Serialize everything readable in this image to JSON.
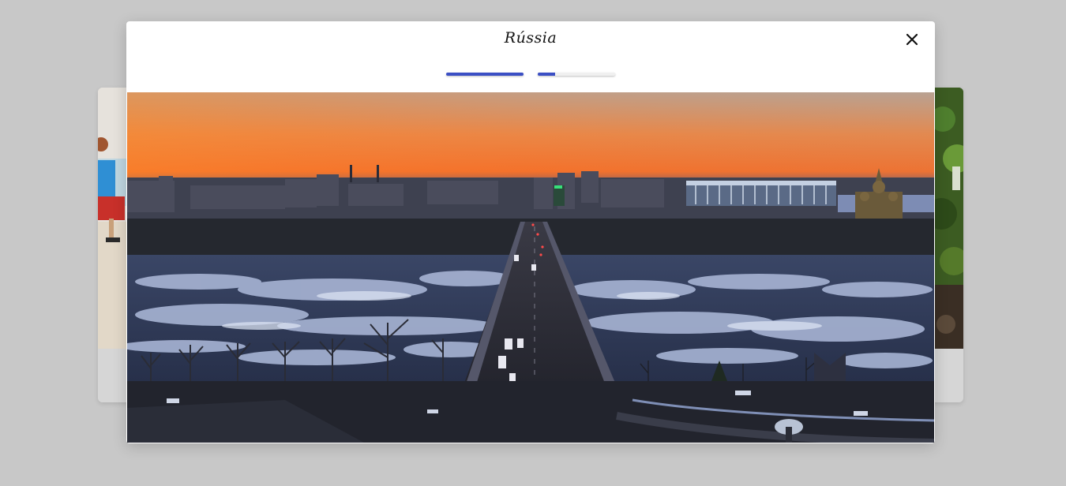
{
  "modal": {
    "title": "Rússia",
    "close_icon": "close-icon",
    "progress": [
      {
        "fraction": 1.0
      },
      {
        "fraction": 0.22
      }
    ],
    "image": {
      "subject": "city-skyline-bridge-sunset"
    }
  },
  "colors": {
    "accent": "#3b4fc4",
    "overlay": "#c8c8c8",
    "sky_top": "#b8a99a",
    "sky_glow": "#f07a2a",
    "ice": "#a9b6d6",
    "water_dark": "#2b3450"
  }
}
